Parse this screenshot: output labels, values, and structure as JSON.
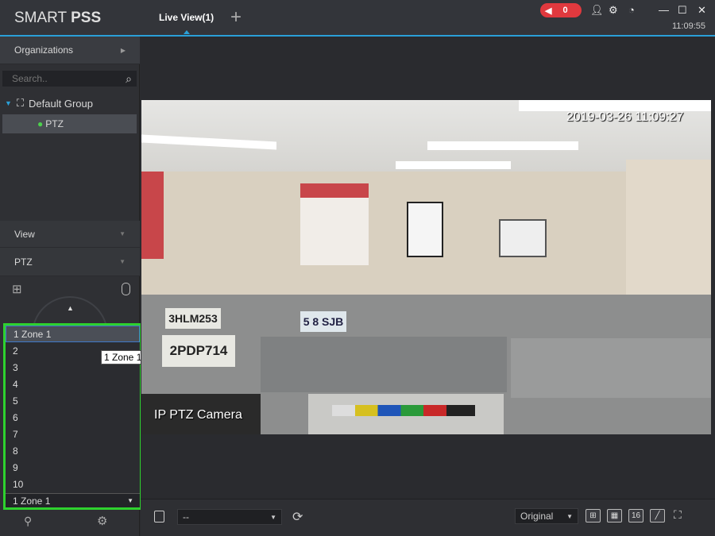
{
  "app": {
    "logo_light": "SMART ",
    "logo_bold": "PSS",
    "tab": "Live View(1)",
    "add_tab": "+",
    "alarm_count": "0",
    "clock": "11:09:55"
  },
  "sidebar": {
    "organizations": "Organizations",
    "search_placeholder": "Search..",
    "group": "Default Group",
    "device": "PTZ",
    "view": "View",
    "ptz": "PTZ"
  },
  "zones": {
    "items": [
      "1  Zone 1",
      "2",
      "3",
      "4",
      "5",
      "6",
      "7",
      "8",
      "9",
      "10"
    ],
    "selected": "1  Zone 1",
    "tooltip": "1  Zone 1"
  },
  "video": {
    "timestamp": "2019-03-26 11:09:27",
    "channel_name": "IP PTZ Camera",
    "plates": [
      "3HLM253",
      "2PDP714",
      "5 8 SJB"
    ]
  },
  "bottombar": {
    "preset_value": "--",
    "stream_value": "Original",
    "grid16": "16"
  },
  "colors": {
    "accent": "#2aa0d8",
    "alarm": "#e0393e",
    "highlight": "#2ed12e"
  }
}
